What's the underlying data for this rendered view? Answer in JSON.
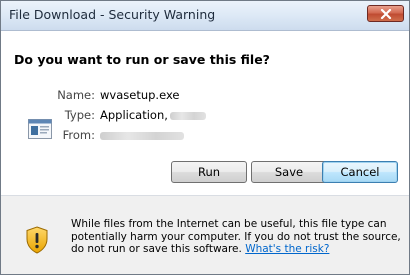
{
  "window": {
    "title": "File Download - Security Warning"
  },
  "dialog": {
    "question": "Do you want to run or save this file?",
    "fields": [
      {
        "label": "Name:",
        "value": "wvasetup.exe"
      },
      {
        "label": "Type:",
        "value": "Application,"
      },
      {
        "label": "From:",
        "value": ""
      }
    ]
  },
  "buttons": {
    "run": "Run",
    "save": "Save",
    "cancel": "Cancel"
  },
  "footer": {
    "warning_text": "While files from the Internet can be useful, this file type can potentially harm your computer. If you do not trust the source, do not run or save this software.",
    "risk_link": "What's the risk?"
  },
  "icons": {
    "close": "close-icon",
    "file": "application-file-icon",
    "warning": "shield-warning-icon"
  },
  "colors": {
    "close_button": "#c04c32",
    "link": "#0066cc",
    "footer_bg": "#f0f0f0"
  }
}
